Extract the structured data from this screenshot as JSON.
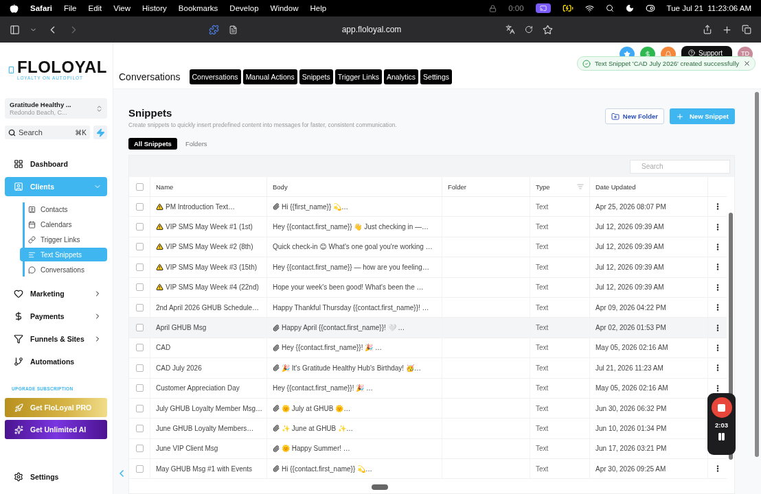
{
  "menubar": {
    "app": "Safari",
    "menus": [
      "File",
      "Edit",
      "View",
      "History",
      "Bookmarks",
      "Develop",
      "Window",
      "Help"
    ],
    "timer": "0:00",
    "clock": "Tue Jul 21  11:23:06 AM"
  },
  "browser": {
    "url": "app.floloyal.com"
  },
  "sidebar": {
    "logo": "FLOLOYAL",
    "tagline": "LOYALTY ON AUTOPILOT",
    "location": {
      "name": "Gratitude Healthy ...",
      "address": "Redondo Beach, C..."
    },
    "search": {
      "placeholder": "Search",
      "shortcut": "⌘K"
    },
    "nav": [
      {
        "label": "Dashboard",
        "kind": "link",
        "selected": false
      },
      {
        "label": "Clients",
        "kind": "group",
        "selected": true,
        "expanded": true,
        "children": [
          {
            "label": "Contacts",
            "selected": false
          },
          {
            "label": "Calendars",
            "selected": false
          },
          {
            "label": "Trigger Links",
            "selected": false
          },
          {
            "label": "Text Snippets",
            "selected": true
          },
          {
            "label": "Conversations",
            "selected": false
          }
        ]
      },
      {
        "label": "Marketing",
        "kind": "group",
        "selected": false,
        "expanded": false
      },
      {
        "label": "Payments",
        "kind": "group",
        "selected": false,
        "expanded": false
      },
      {
        "label": "Funnels & Sites",
        "kind": "group",
        "selected": false,
        "expanded": false
      },
      {
        "label": "Automations",
        "kind": "link",
        "selected": false
      }
    ],
    "upgrade": {
      "heading": "UPGRADE SUBSCRIPTION",
      "buttons": [
        {
          "label": "Get FloLoyal PRO",
          "kind": "pro"
        },
        {
          "label": "Get Unlimited AI",
          "kind": "ai"
        }
      ]
    },
    "footer": {
      "label": "Settings"
    }
  },
  "header": {
    "title": "Conversations",
    "tabs": [
      "Conversations",
      "Manual Actions",
      "Snippets",
      "Trigger Links",
      "Analytics",
      "Settings"
    ],
    "support": "Support",
    "avatar": "TD"
  },
  "toast": {
    "message": "Text Snippet 'CAD July 2026' created successfully"
  },
  "page": {
    "title": "Snippets",
    "subtitle": "Create snippets to quickly insert predefined content into messages for faster, consistent communication.",
    "tabs": [
      {
        "label": "All Snippets",
        "selected": true
      },
      {
        "label": "Folders",
        "selected": false
      }
    ],
    "new_folder": "New Folder",
    "new_snippet": "New Snippet",
    "table": {
      "search_placeholder": "Search",
      "select_all": {
        "checked": false
      },
      "columns": [
        "Name",
        "Body",
        "Folder",
        "Type",
        "Date Updated"
      ],
      "rows": [
        {
          "name": "PM Introduction Text…",
          "warning": true,
          "body": "Hi {{first_name}} 💫…",
          "attachment": true,
          "type": "Text",
          "date": "Apr 25, 2026 08:07 PM",
          "checked": false,
          "highlighted": false,
          "menu": true
        },
        {
          "name": "VIP SMS May Week #1 (1st)",
          "warning": true,
          "body": "Hey {{contact.first_name}} 👋 Just checking in —…",
          "attachment": false,
          "type": "Text",
          "date": "Jul 12, 2026 09:39 AM",
          "checked": false,
          "highlighted": false,
          "menu": true
        },
        {
          "name": "VIP SMS May Week #2 (8th)",
          "warning": true,
          "body": "Quick check-in 😊 What's one goal you're working …",
          "attachment": false,
          "type": "Text",
          "date": "Jul 12, 2026 09:39 AM",
          "checked": false,
          "highlighted": false,
          "menu": true
        },
        {
          "name": "VIP SMS May Week #3 (15th)",
          "warning": true,
          "body": "Hey {{contact.first_name}} — how are you feeling…",
          "attachment": false,
          "type": "Text",
          "date": "Jul 12, 2026 09:39 AM",
          "checked": false,
          "highlighted": false,
          "menu": true
        },
        {
          "name": "VIP SMS May Week #4 (22nd)",
          "warning": true,
          "body": "Hope your week's been good! What's been the …",
          "attachment": false,
          "type": "Text",
          "date": "Jul 12, 2026 09:39 AM",
          "checked": false,
          "highlighted": false,
          "menu": true
        },
        {
          "name": "2nd April 2026 GHUB Schedule…",
          "warning": false,
          "body": "Happy Thankful Thursday {{contact.first_name}}! …",
          "attachment": false,
          "type": "Text",
          "date": "Apr 09, 2026 04:22 PM",
          "checked": false,
          "highlighted": false,
          "menu": true
        },
        {
          "name": "April GHUB Msg",
          "warning": false,
          "body": "Happy April {{contact.first_name}}! 🤍 …",
          "attachment": true,
          "type": "Text",
          "date": "Apr 02, 2026 01:53 PM",
          "checked": false,
          "highlighted": true,
          "menu": true
        },
        {
          "name": "CAD",
          "warning": false,
          "body": "Hey {{contact.first_name}}! 🎉 …",
          "attachment": true,
          "type": "Text",
          "date": "May 05, 2026 02:16 AM",
          "checked": false,
          "highlighted": false,
          "menu": true
        },
        {
          "name": "CAD July 2026",
          "warning": false,
          "body": "🎉 It's Gratitude Healthy Hub's Birthday! 🥳…",
          "attachment": true,
          "type": "Text",
          "date": "Jul 21, 2026 11:23 AM",
          "checked": false,
          "highlighted": false,
          "menu": true
        },
        {
          "name": "Customer Appreciation Day",
          "warning": false,
          "body": "Hey {{contact.first_name}}! 🎉 …",
          "attachment": false,
          "type": "Text",
          "date": "May 05, 2026 02:16 AM",
          "checked": false,
          "highlighted": false,
          "menu": true
        },
        {
          "name": "July GHUB Loyalty Member Msg…",
          "warning": false,
          "body": "🌞 July at GHUB 🌞…",
          "attachment": true,
          "type": "Text",
          "date": "Jun 30, 2026 06:32 PM",
          "checked": false,
          "highlighted": false,
          "menu": false
        },
        {
          "name": "June GHUB Loyalty Members…",
          "warning": false,
          "body": "✨ June at GHUB ✨…",
          "attachment": true,
          "type": "Text",
          "date": "Jun 10, 2026 01:34 PM",
          "checked": false,
          "highlighted": false,
          "menu": false
        },
        {
          "name": "June VIP Client Msg",
          "warning": false,
          "body": "🌞 Happy Summer! …",
          "attachment": true,
          "type": "Text",
          "date": "Jun 17, 2026 03:21 PM",
          "checked": false,
          "highlighted": false,
          "menu": false
        },
        {
          "name": "May GHUB Msg #1 with Events",
          "warning": false,
          "body": "Hi {{contact.first_name}} 💫…",
          "attachment": true,
          "type": "Text",
          "date": "Apr 30, 2026 09:25 AM",
          "checked": false,
          "highlighted": false,
          "menu": true
        }
      ]
    }
  },
  "recorder": {
    "time": "2:03"
  }
}
